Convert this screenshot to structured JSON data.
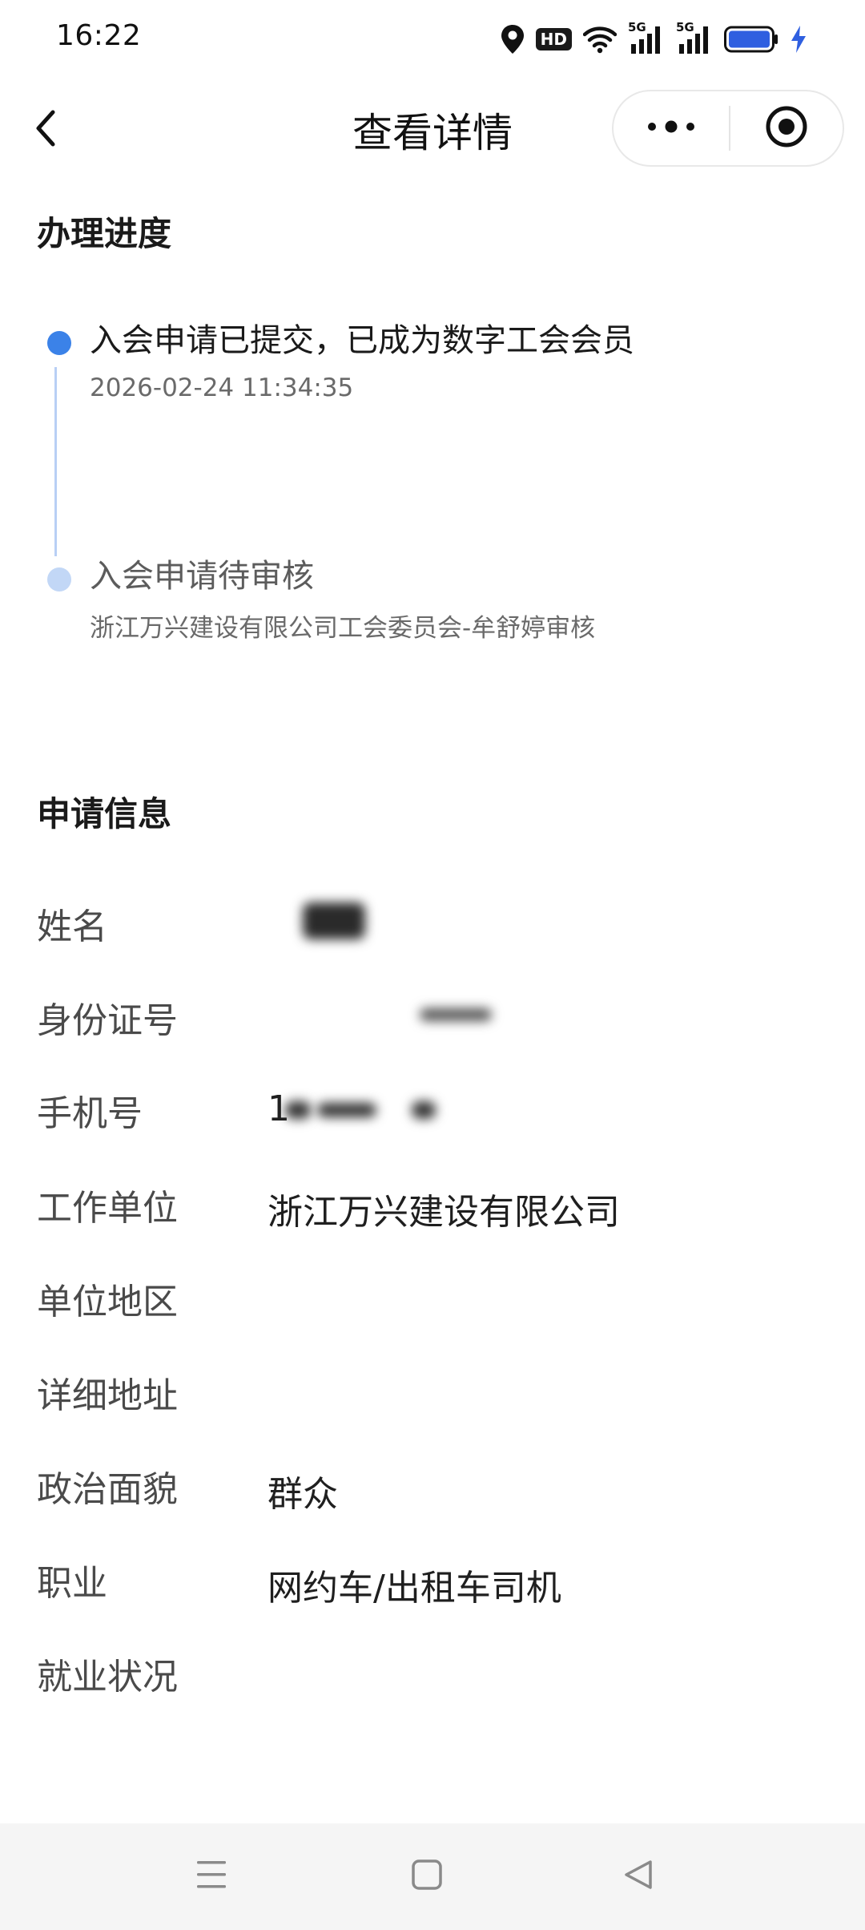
{
  "status_bar": {
    "time": "16:22",
    "hd_badge": "HD",
    "signal_1_label": "5G",
    "signal_2_label": "5G",
    "battery_color": "#2f5fe0",
    "charging_color": "#2f5fe0"
  },
  "nav": {
    "title": "查看详情"
  },
  "progress": {
    "section_title": "办理进度",
    "steps": [
      {
        "title": "入会申请已提交，已成为数字工会会员",
        "subtitle": "2026-02-24 11:34:35",
        "state": "active"
      },
      {
        "title": "入会申请待审核",
        "subtitle": "浙江万兴建设有限公司工会委员会-牟舒婷审核",
        "state": "pending"
      }
    ],
    "active_color": "#3b82e8",
    "pending_color": "#c2d7f6"
  },
  "application": {
    "section_title": "申请信息",
    "fields": [
      {
        "label": "姓名",
        "value": ""
      },
      {
        "label": "身份证号",
        "value": ""
      },
      {
        "label": "手机号",
        "value": "1"
      },
      {
        "label": "工作单位",
        "value": "浙江万兴建设有限公司"
      },
      {
        "label": "单位地区",
        "value": ""
      },
      {
        "label": "详细地址",
        "value": ""
      },
      {
        "label": "政治面貌",
        "value": "群众"
      },
      {
        "label": "职业",
        "value": "网约车/出租车司机"
      },
      {
        "label": "就业状况",
        "value": ""
      }
    ]
  }
}
